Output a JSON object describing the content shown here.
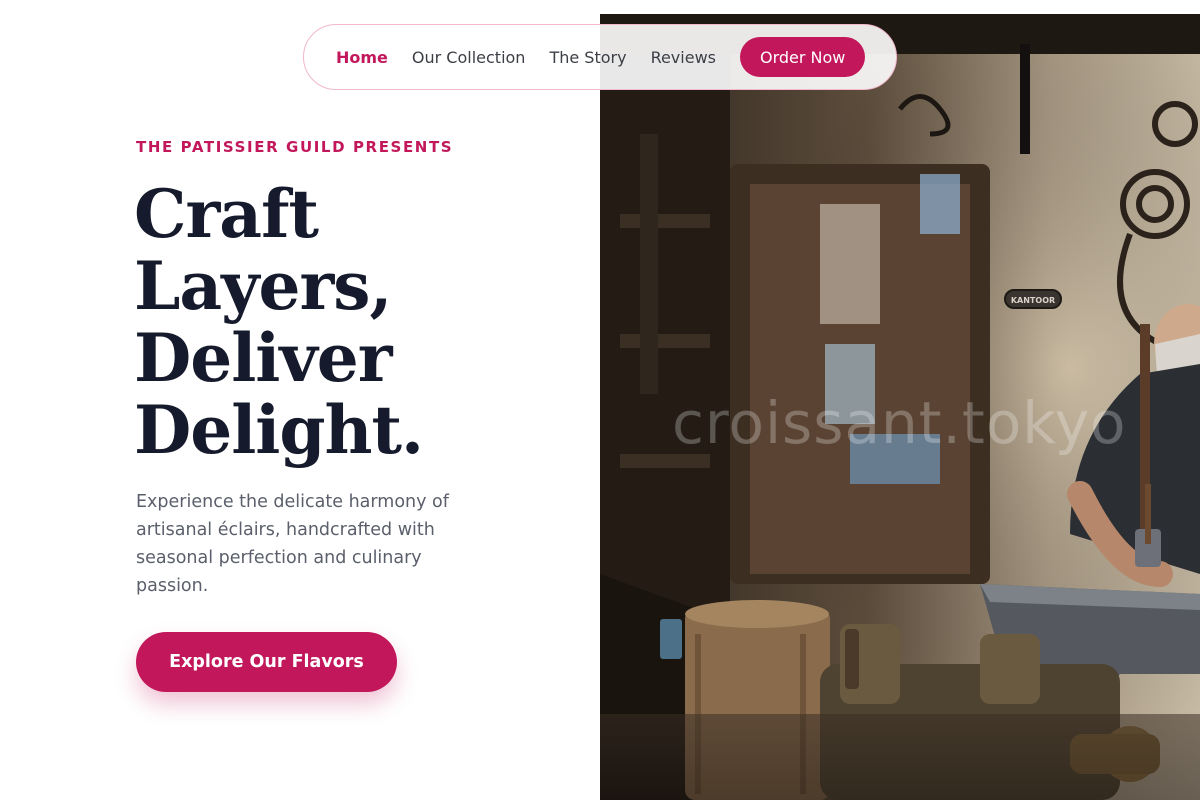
{
  "nav": {
    "links": [
      {
        "label": "Home",
        "active": true
      },
      {
        "label": "Our Collection",
        "active": false
      },
      {
        "label": "The Story",
        "active": false
      },
      {
        "label": "Reviews",
        "active": false
      }
    ],
    "cta_label": "Order Now"
  },
  "hero": {
    "eyebrow": "THE PATISSIER GUILD PRESENTS",
    "headline_lines": [
      "Craft",
      "Layers,",
      "Deliver",
      "Delight."
    ],
    "lede": "Experience the delicate harmony of artisanal éclairs, handcrafted with seasonal perfection and culinary passion.",
    "cta_label": "Explore Our Flavors"
  },
  "photo": {
    "watermark": "croissant.tokyo",
    "sign_text": "KANTOOR"
  },
  "colors": {
    "accent": "#c2185b",
    "heading": "#151a2c",
    "body_text": "#5a5f6b",
    "nav_border": "#f1b7cb"
  }
}
